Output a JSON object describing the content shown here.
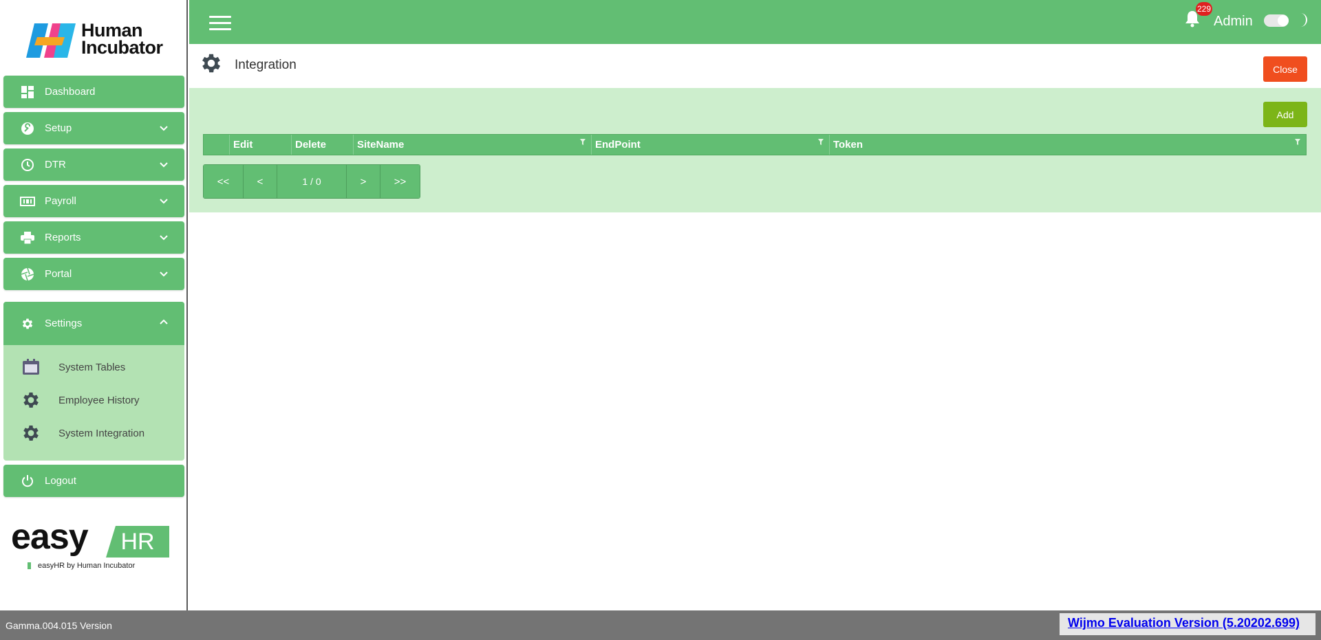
{
  "brand": {
    "logo_text_line1": "Human",
    "logo_text_line2": "Incubator"
  },
  "sidebar": {
    "items": [
      {
        "label": "Dashboard",
        "icon": "dashboard-icon"
      },
      {
        "label": "Setup",
        "icon": "wrench-icon"
      },
      {
        "label": "DTR",
        "icon": "clock-icon"
      },
      {
        "label": "Payroll",
        "icon": "money-icon"
      },
      {
        "label": "Reports",
        "icon": "printer-icon"
      },
      {
        "label": "Portal",
        "icon": "aperture-icon"
      }
    ],
    "settings": {
      "label": "Settings",
      "icon": "gear-icon",
      "expanded": true,
      "sub_items": [
        {
          "label": "System Tables",
          "icon": "calendar-icon"
        },
        {
          "label": "Employee History",
          "icon": "gear-icon"
        },
        {
          "label": "System Integration",
          "icon": "gear-icon"
        }
      ]
    },
    "logout": {
      "label": "Logout",
      "icon": "power-icon"
    },
    "product": {
      "word": "easy",
      "hr": "HR",
      "tagline": "easyHR by Human Incubator"
    }
  },
  "topbar": {
    "notification_count": "229",
    "user": "Admin",
    "dark_mode": false
  },
  "page": {
    "title": "Integration",
    "close_label": "Close"
  },
  "panel": {
    "add_label": "Add",
    "grid_columns": [
      "Edit",
      "Delete",
      "SiteName",
      "EndPoint",
      "Token"
    ],
    "pager": {
      "first": "<<",
      "prev": "<",
      "info": "1 / 0",
      "next": ">",
      "last": ">>"
    }
  },
  "footer": {
    "version": "Gamma.004.015 Version",
    "wijmo": "Wijmo Evaluation Version (5.20202.699)"
  },
  "colors": {
    "primary": "#62be73",
    "panel": "#cdeecd",
    "close": "#f04e1e",
    "add": "#7cb518",
    "footer": "#747474"
  }
}
